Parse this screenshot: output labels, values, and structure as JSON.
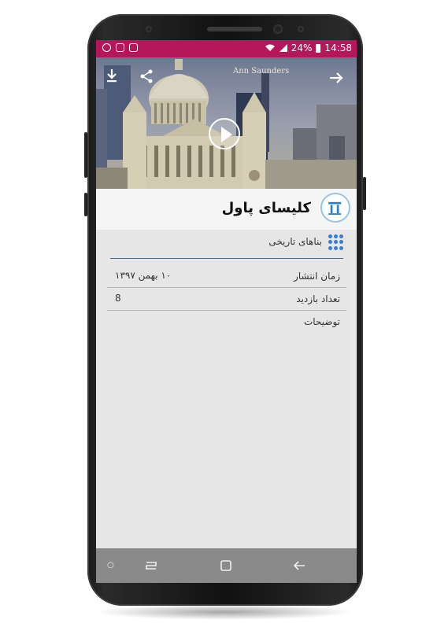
{
  "status_bar": {
    "battery": "24%",
    "time": "14:58"
  },
  "hero": {
    "author": "Ann Saunders",
    "icons": [
      "download-icon",
      "share-icon",
      "forward-arrow-icon",
      "play-icon"
    ]
  },
  "header": {
    "title": "کلیسای پاول"
  },
  "category": {
    "label": "بناهای تاریخی"
  },
  "info": {
    "publish_label": "زمان انتشار",
    "publish_value": "۱۰ بهمن ۱۳۹۷",
    "visits_label": "تعداد بازدید",
    "visits_value": "8",
    "desc_label": "توضیحات"
  },
  "colors": {
    "status_bar": "#b4175a",
    "accent": "#3a7bd5"
  }
}
